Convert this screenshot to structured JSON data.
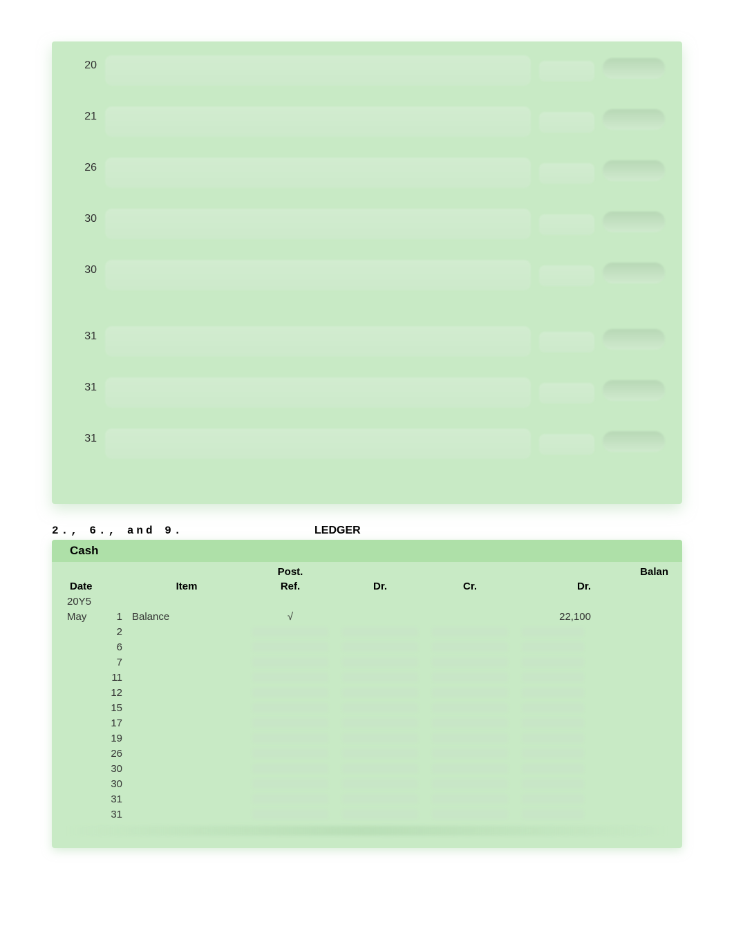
{
  "journal": {
    "rows": [
      {
        "day": "20"
      },
      {
        "day": "21"
      },
      {
        "day": "26"
      },
      {
        "day": "30"
      },
      {
        "day": "30"
      },
      {
        "day": "31"
      },
      {
        "day": "31"
      },
      {
        "day": "31"
      }
    ]
  },
  "section_label": {
    "left": "2., 6., and 9.",
    "center": "LEDGER"
  },
  "ledger": {
    "account_title": "Cash",
    "headers": {
      "date": "Date",
      "item": "Item",
      "post_ref": "Post.\nRef.",
      "dr": "Dr.",
      "cr": "Cr.",
      "dr_bal": "Dr.",
      "balan": "Balan"
    },
    "year": "20Y5",
    "rows": [
      {
        "month": "May",
        "day": "1",
        "item": "Balance",
        "post_ref": "√",
        "dr": "",
        "cr": "",
        "dr_bal": "22,100"
      },
      {
        "month": "",
        "day": "2",
        "item": "",
        "post_ref": "",
        "dr": "",
        "cr": "",
        "dr_bal": ""
      },
      {
        "month": "",
        "day": "6",
        "item": "",
        "post_ref": "",
        "dr": "",
        "cr": "",
        "dr_bal": ""
      },
      {
        "month": "",
        "day": "7",
        "item": "",
        "post_ref": "",
        "dr": "",
        "cr": "",
        "dr_bal": ""
      },
      {
        "month": "",
        "day": "11",
        "item": "",
        "post_ref": "",
        "dr": "",
        "cr": "",
        "dr_bal": ""
      },
      {
        "month": "",
        "day": "12",
        "item": "",
        "post_ref": "",
        "dr": "",
        "cr": "",
        "dr_bal": ""
      },
      {
        "month": "",
        "day": "15",
        "item": "",
        "post_ref": "",
        "dr": "",
        "cr": "",
        "dr_bal": ""
      },
      {
        "month": "",
        "day": "17",
        "item": "",
        "post_ref": "",
        "dr": "",
        "cr": "",
        "dr_bal": ""
      },
      {
        "month": "",
        "day": "19",
        "item": "",
        "post_ref": "",
        "dr": "",
        "cr": "",
        "dr_bal": ""
      },
      {
        "month": "",
        "day": "26",
        "item": "",
        "post_ref": "",
        "dr": "",
        "cr": "",
        "dr_bal": ""
      },
      {
        "month": "",
        "day": "30",
        "item": "",
        "post_ref": "",
        "dr": "",
        "cr": "",
        "dr_bal": ""
      },
      {
        "month": "",
        "day": "30",
        "item": "",
        "post_ref": "",
        "dr": "",
        "cr": "",
        "dr_bal": ""
      },
      {
        "month": "",
        "day": "31",
        "item": "",
        "post_ref": "",
        "dr": "",
        "cr": "",
        "dr_bal": ""
      },
      {
        "month": "",
        "day": "31",
        "item": "",
        "post_ref": "",
        "dr": "",
        "cr": "",
        "dr_bal": ""
      }
    ]
  }
}
